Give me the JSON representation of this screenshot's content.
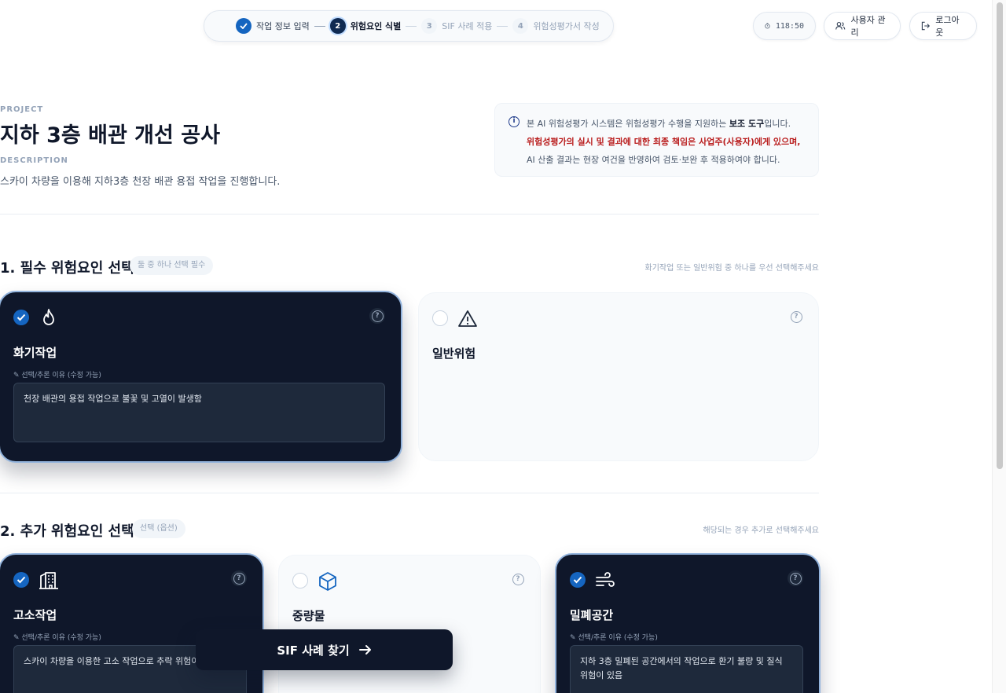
{
  "stepper": {
    "steps": [
      {
        "num": "✓",
        "label": "작업 정보 입력"
      },
      {
        "num": "2",
        "label": "위험요인 식별"
      },
      {
        "num": "3",
        "label": "SIF 사례 적용"
      },
      {
        "num": "4",
        "label": "위험성평가서 작성"
      }
    ],
    "current_step": 2
  },
  "header": {
    "timer": "118:50",
    "user_mgmt_label": "사용자 관리",
    "logout_label": "로그아웃"
  },
  "project": {
    "eyebrow": "PROJECT",
    "title": "지하 3층 배관 개선 공사",
    "desc_eyebrow": "DESCRIPTION",
    "description": "스카이 차량을 이용해 지하3층 천장 배관 용접 작업을 진행합니다."
  },
  "notice": {
    "line1_pre": "본 AI 위험성평가 시스템은 위험성평가 수행을 지원하는 ",
    "line1_bold": "보조 도구",
    "line1_post": "입니다.",
    "line2": "위험성평가의 실시 및 결과에 대한 최종 책임은 사업주(사용자)에게 있으며,",
    "line3": "AI 산출 결과는 현장 여건을 반영하여 검토·보완 후 적용하여야 합니다."
  },
  "section1": {
    "title": "1. 필수 위험요인 선택",
    "badge": "둘 중 하나 선택 필수",
    "hint": "화기작업 또는 일반위험 중 하나를 우선 선택해주세요"
  },
  "section2": {
    "title": "2. 추가 위험요인 선택",
    "badge": "선택 (옵션)",
    "hint": "해당되는 경우 추가로 선택해주세요"
  },
  "reason_label": "✎ 선택/추론 이유 (수정 가능)",
  "required_cards": [
    {
      "name": "화기작업",
      "icon": "flame-icon",
      "selected": true,
      "reason": "천장 배관의 용접 작업으로 불꽃 및 고열이 발생함"
    },
    {
      "name": "일반위험",
      "icon": "warning-icon",
      "selected": false
    }
  ],
  "optional_cards": [
    {
      "name": "고소작업",
      "icon": "building-icon",
      "selected": true,
      "reason": "스카이 차량을 이용한 고소 작업으로 추락 위험이 있음"
    },
    {
      "name": "중량물",
      "icon": "box-icon",
      "selected": false
    },
    {
      "name": "밀폐공간",
      "icon": "wind-icon",
      "selected": true,
      "reason": "지하 3층 밀폐된 공간에서의 작업으로 환기 불량 및 질식 위험이 있음"
    }
  ],
  "action": {
    "label": "SIF 사례 찾기"
  },
  "colors": {
    "navy": "#0f172a",
    "accent": "#1565c0",
    "warn": "#b91c1c"
  }
}
